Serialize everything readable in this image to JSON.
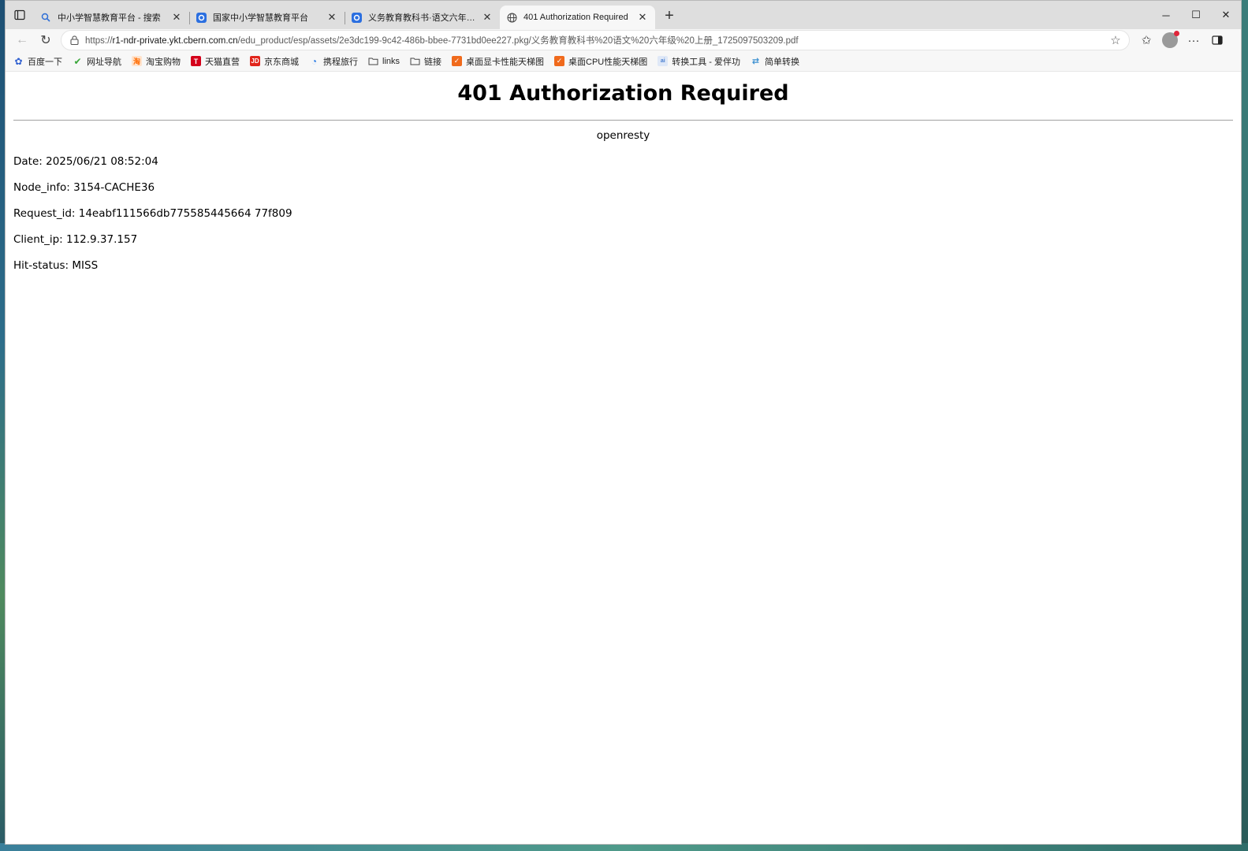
{
  "tabs": [
    {
      "title": "中小学智慧教育平台 - 搜索",
      "icon": "search-icon"
    },
    {
      "title": "国家中小学智慧教育平台",
      "icon": "site-logo-icon"
    },
    {
      "title": "义务教育教科书·语文六年级上册",
      "icon": "site-logo-icon"
    },
    {
      "title": "401 Authorization Required",
      "icon": "globe-icon",
      "active": true
    }
  ],
  "address_bar": {
    "scheme": "https://",
    "host": "r1-ndr-private.ykt.cbern.com.cn",
    "path": "/edu_product/esp/assets/2e3dc199-9c42-486b-bbee-7731bd0ee227.pkg/义务教育教科书%20语文%20六年级%20上册_1725097503209.pdf"
  },
  "bookmarks": [
    {
      "label": "百度一下",
      "icon": "baidu-icon",
      "color": "#2f5fd0"
    },
    {
      "label": "网址导航",
      "icon": "hao123-icon",
      "color": "#3aa63a"
    },
    {
      "label": "淘宝购物",
      "icon": "taobao-icon",
      "color": "#ff6a00"
    },
    {
      "label": "天猫直营",
      "icon": "tmall-icon",
      "color": "#d4001a"
    },
    {
      "label": "京东商城",
      "icon": "jd-icon",
      "color": "#e1251b"
    },
    {
      "label": "携程旅行",
      "icon": "ctrip-icon",
      "color": "#2a7be4"
    },
    {
      "label": "links",
      "icon": "folder-icon",
      "color": ""
    },
    {
      "label": "链接",
      "icon": "folder-icon",
      "color": ""
    },
    {
      "label": "桌面显卡性能天梯图",
      "icon": "orange-shield-icon",
      "color": "#f06a1c"
    },
    {
      "label": "桌面CPU性能天梯图",
      "icon": "orange-shield-icon",
      "color": "#f06a1c"
    },
    {
      "label": "转换工具 - 爱伴功",
      "icon": "tool-icon",
      "color": "#4a7fd0"
    },
    {
      "label": "简单转换",
      "icon": "convert-icon",
      "color": "#3a8fd0"
    }
  ],
  "page": {
    "heading": "401 Authorization Required",
    "server": "openresty",
    "lines": [
      "Date: 2025/06/21 08:52:04",
      "Node_info: 3154-CACHE36",
      "Request_id: 14eabf111566db775585445664 77f809",
      "Client_ip: 112.9.37.157",
      "Hit-status: MISS"
    ]
  }
}
